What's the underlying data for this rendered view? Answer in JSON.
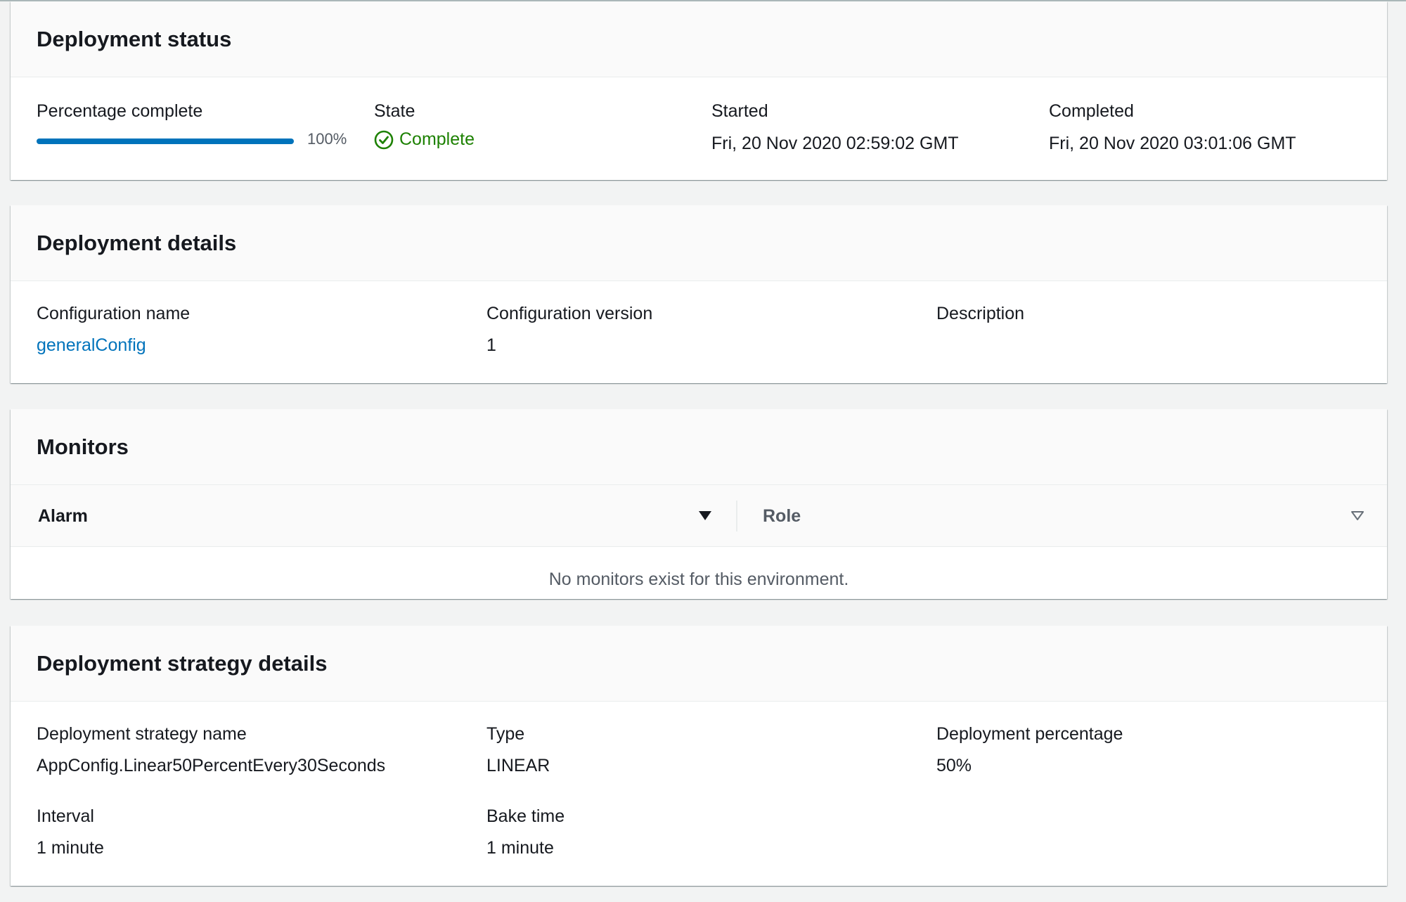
{
  "status_panel": {
    "title": "Deployment status",
    "percentage_label": "Percentage complete",
    "percentage_text": "100%",
    "percentage_value": 1.0,
    "state_label": "State",
    "state_value": "Complete",
    "started_label": "Started",
    "started_value": "Fri, 20 Nov 2020 02:59:02 GMT",
    "completed_label": "Completed",
    "completed_value": "Fri, 20 Nov 2020 03:01:06 GMT"
  },
  "details_panel": {
    "title": "Deployment details",
    "config_name_label": "Configuration name",
    "config_name_value": "generalConfig",
    "config_version_label": "Configuration version",
    "config_version_value": "1",
    "description_label": "Description",
    "description_value": ""
  },
  "monitors_panel": {
    "title": "Monitors",
    "columns": [
      {
        "label": "Alarm",
        "sort_icon": "sort-descending-icon"
      },
      {
        "label": "Role",
        "sort_icon": "sort-unsorted-icon"
      }
    ],
    "empty_message": "No monitors exist for this environment."
  },
  "strategy_panel": {
    "title": "Deployment strategy details",
    "name_label": "Deployment strategy name",
    "name_value": "AppConfig.Linear50PercentEvery30Seconds",
    "type_label": "Type",
    "type_value": "LINEAR",
    "percentage_label": "Deployment percentage",
    "percentage_value": "50%",
    "interval_label": "Interval",
    "interval_value": "1 minute",
    "bake_label": "Bake time",
    "bake_value": "1 minute"
  },
  "colors": {
    "link": "#0073bb",
    "success": "#1d8102",
    "progress": "#0073bb"
  }
}
